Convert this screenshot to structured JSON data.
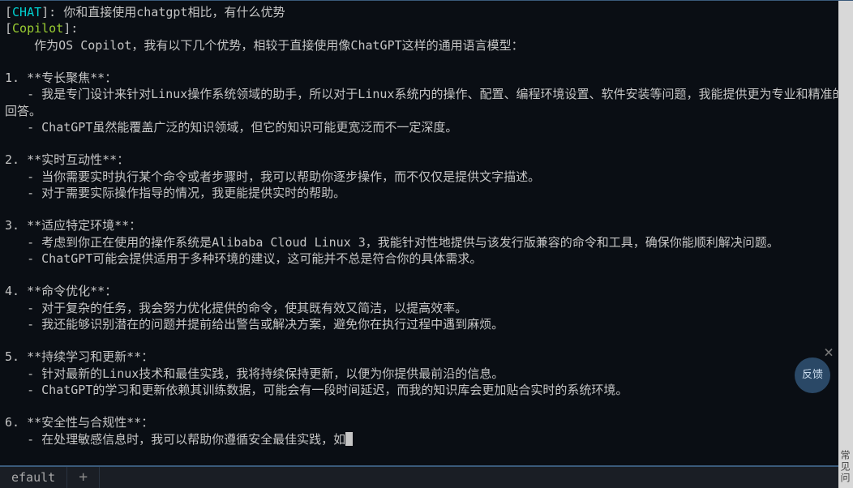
{
  "chat_label": "CHAT",
  "copilot_label": "Copilot",
  "user_message": "你和直接使用chatgpt相比，有什么优势",
  "reply_intro": "    作为OS Copilot，我有以下几个优势，相较于直接使用像ChatGPT这样的通用语言模型：",
  "sections": [
    {
      "num": "1.",
      "title": "**专长聚焦**：",
      "lines": [
        "   - 我是专门设计来针对Linux操作系统领域的助手，所以对于Linux系统内的操作、配置、编程环境设置、软件安装等问题，我能提供更为专业和精准的回答。",
        "   - ChatGPT虽然能覆盖广泛的知识领域，但它的知识可能更宽泛而不一定深度。"
      ]
    },
    {
      "num": "2.",
      "title": "**实时互动性**：",
      "lines": [
        "   - 当你需要实时执行某个命令或者步骤时，我可以帮助你逐步操作，而不仅仅是提供文字描述。",
        "   - 对于需要实际操作指导的情况，我更能提供实时的帮助。"
      ]
    },
    {
      "num": "3.",
      "title": "**适应特定环境**：",
      "lines": [
        "   - 考虑到你正在使用的操作系统是Alibaba Cloud Linux 3，我能针对性地提供与该发行版兼容的命令和工具，确保你能顺利解决问题。",
        "   - ChatGPT可能会提供适用于多种环境的建议，这可能并不总是符合你的具体需求。"
      ]
    },
    {
      "num": "4.",
      "title": "**命令优化**：",
      "lines": [
        "   - 对于复杂的任务，我会努力优化提供的命令，使其既有效又简洁，以提高效率。",
        "   - 我还能够识别潜在的问题并提前给出警告或解决方案，避免你在执行过程中遇到麻烦。"
      ]
    },
    {
      "num": "5.",
      "title": "**持续学习和更新**：",
      "lines": [
        "   - 针对最新的Linux技术和最佳实践，我将持续保持更新，以便为你提供最前沿的信息。",
        "   - ChatGPT的学习和更新依赖其训练数据，可能会有一段时间延迟，而我的知识库会更加贴合实时的系统环境。"
      ]
    },
    {
      "num": "6.",
      "title": "**安全性与合规性**：",
      "lines": [
        "   - 在处理敏感信息时，我可以帮助你遵循安全最佳实践，如"
      ]
    }
  ],
  "tabs": {
    "default": "efault",
    "add": "+"
  },
  "feedback": "反馈",
  "close": "×",
  "sidebar_text": "常见问"
}
